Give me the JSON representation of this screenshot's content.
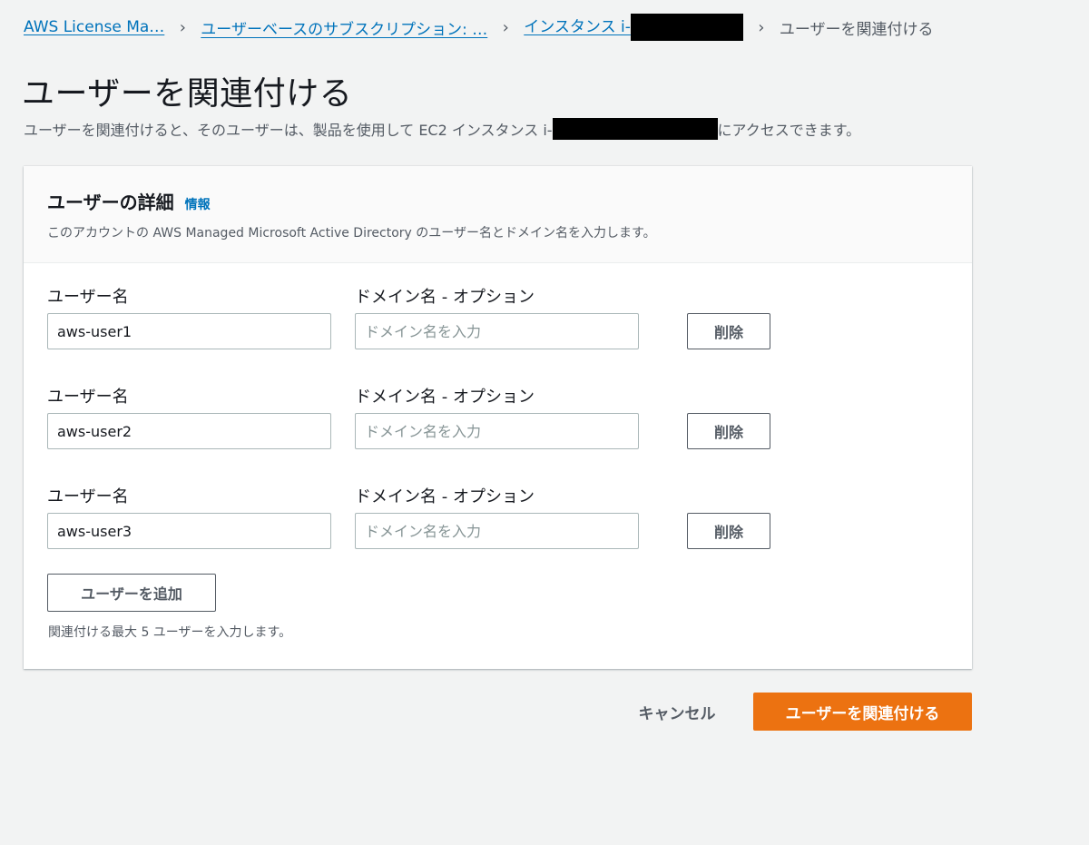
{
  "breadcrumb": {
    "items": [
      "AWS License Ma…",
      "ユーザーベースのサブスクリプション: …",
      "インスタンス i-"
    ],
    "current": "ユーザーを関連付ける"
  },
  "page": {
    "title": "ユーザーを関連付ける",
    "description_before": "ユーザーを関連付けると、そのユーザーは、製品を使用して EC2 インスタンス i-",
    "description_after": "にアクセスできます。"
  },
  "panel": {
    "title": "ユーザーの詳細",
    "info_link": "情報",
    "description": "このアカウントの AWS Managed Microsoft Active Directory のユーザー名とドメイン名を入力します。"
  },
  "user_rows": [
    {
      "user_label": "ユーザー名",
      "user_value": "aws-user1",
      "domain_label": "ドメイン名 - オプション",
      "domain_placeholder": "ドメイン名を入力",
      "remove_label": "削除"
    },
    {
      "user_label": "ユーザー名",
      "user_value": "aws-user2",
      "domain_label": "ドメイン名 - オプション",
      "domain_placeholder": "ドメイン名を入力",
      "remove_label": "削除"
    },
    {
      "user_label": "ユーザー名",
      "user_value": "aws-user3",
      "domain_label": "ドメイン名 - オプション",
      "domain_placeholder": "ドメイン名を入力",
      "remove_label": "削除"
    }
  ],
  "add_user_label": "ユーザーを追加",
  "hint": "関連付ける最大 5 ユーザーを入力します。",
  "actions": {
    "cancel_label": "キャンセル",
    "submit_label": "ユーザーを関連付ける"
  },
  "colors": {
    "link": "#0073bb",
    "primary": "#ec7211",
    "background": "#f2f3f3"
  }
}
